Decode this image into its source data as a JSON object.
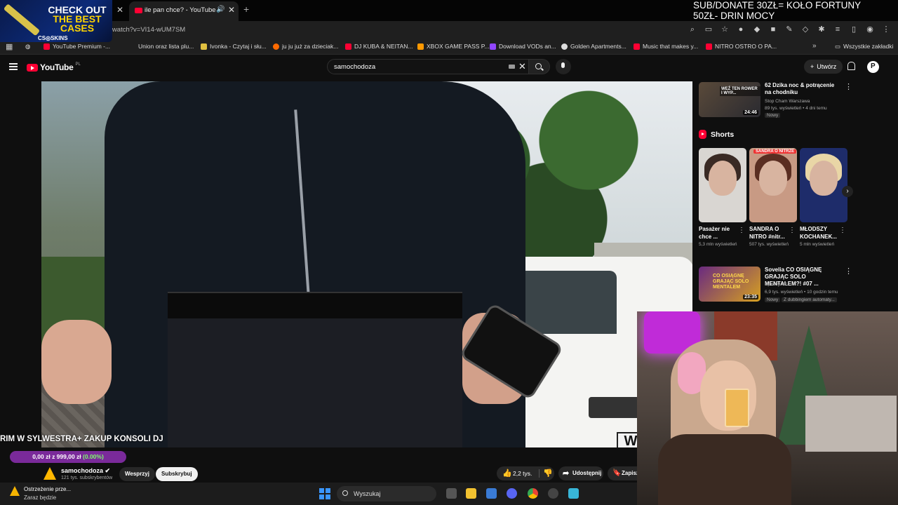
{
  "browser": {
    "promo": {
      "line1": "CHECK OUT",
      "line2": "THE BEST",
      "line3": "CASES",
      "brand": "CS◎SKINS"
    },
    "active_tab_title": "ile pan chce? - YouTube",
    "url": "n/watch?v=VI14-wUM7SM",
    "bookmarks": [
      {
        "label": "YouTube Premium -...",
        "color": "#ff0033"
      },
      {
        "label": "Union oraz lista plu...",
        "color": ""
      },
      {
        "label": "Ivonka - Czytaj i słu...",
        "color": "#e0c040"
      },
      {
        "label": "ju ju już za dzieciak...",
        "color": "#ff6a00"
      },
      {
        "label": "DJ KUBA & NEITAN...",
        "color": "#ff0033"
      },
      {
        "label": "XBOX GAME PASS P...",
        "color": "#ff9900"
      },
      {
        "label": "Download VODs an...",
        "color": "#9146ff"
      },
      {
        "label": "Golden Apartments...",
        "color": "#dddddd"
      },
      {
        "label": "Music that makes y...",
        "color": "#ff0033"
      },
      {
        "label": "NITRO OSTRO O PA...",
        "color": "#ff0033"
      }
    ],
    "all_bookmarks": "Wszystkie zakładki"
  },
  "stream_overlay": {
    "line1": "SUB/DONATE 30ZŁ= KOŁO FORTUNY",
    "line2": "50ZŁ- DRIN MOCY",
    "title_strip": "RIM W SYLWESTRA+ ZAKUP KONSOLI DJ",
    "goal": {
      "text_prefix": "0,00 zł z 999,00 zł",
      "percent_text": "(0.00%)",
      "progress": 0.0
    }
  },
  "youtube": {
    "logo": "YouTube",
    "logo_cc": "PL",
    "search_value": "samochodoza",
    "create_label": "Utwórz",
    "channel": {
      "name": "samochodoza",
      "subs": "121 tys. subskrybentów"
    },
    "support_label": "Wesprzyj",
    "subscribe_label": "Subskrybuj",
    "likes": "2,2 tys.",
    "share_label": "Udostępnij",
    "save_label": "Zapisz",
    "rec_top": {
      "title": "62 Dzika noc & potrącenie na chodniku",
      "channel": "Stop Cham Warszawa",
      "meta": "89 tys. wyświetleń • 4 dni temu",
      "badge": "Nowy",
      "duration": "24:46",
      "thumb_text": "WEŹ TEN ROWER I WYP..."
    },
    "shorts_title": "Shorts",
    "shorts": [
      {
        "name": "Pasażer nie chce ...",
        "views": "5,3 mln wyświetleń",
        "tag": "",
        "hair": "#3a2a24",
        "bg": "#d9d6d2"
      },
      {
        "name": "SANDRA O NITRO #nitr...",
        "views": "507 tys. wyświetleń",
        "tag": "SANDRA O NITRZE",
        "hair": "#5a2e22",
        "bg": "#c89a84"
      },
      {
        "name": "MŁODSZY KOCHANEK...",
        "views": "5 mln wyświetleń",
        "tag": "",
        "hair": "#e9d6a6",
        "bg": "#1e2c6a"
      }
    ],
    "rec_second": {
      "title": "Sovelia CO OSIĄGNĘ GRAJĄC SOLO MENTALEM?! #07 ...",
      "channel": "Speedy V2",
      "meta": "6,9 tys. wyświetleń • 10 godzin temu",
      "badge": "Nowy",
      "badge2": "Z dubbingiem automaty...",
      "duration": "23:35",
      "thumb_text": "CO OSIĄGNĘ GRAJĄC SOLO MENTALEM"
    }
  },
  "taskbar": {
    "warning_title": "Ostrzeżenie prze...",
    "warning_sub": "Zaraz będzie",
    "search_label": "Wyszukaj"
  }
}
